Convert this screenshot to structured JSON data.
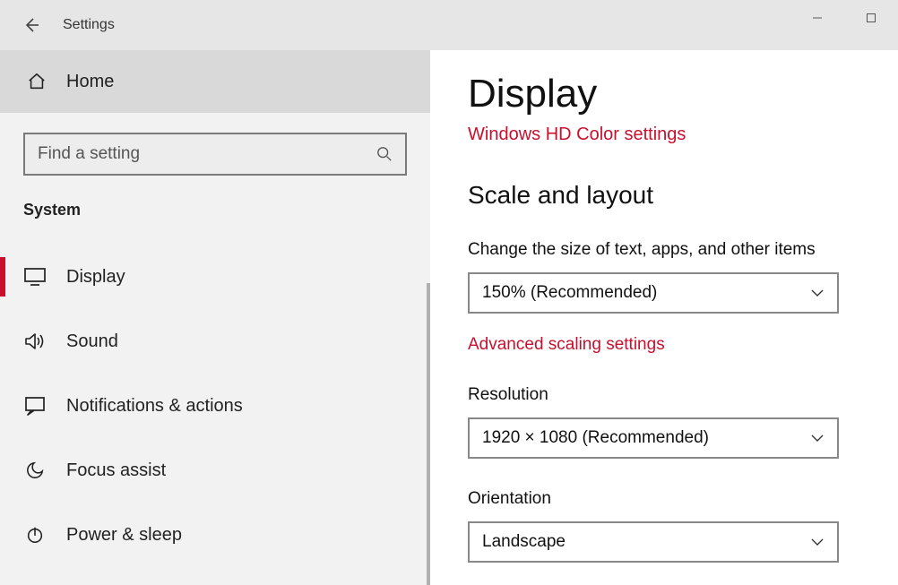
{
  "titlebar": {
    "label": "Settings"
  },
  "sidebar": {
    "home_label": "Home",
    "search_placeholder": "Find a setting",
    "category_label": "System",
    "items": [
      {
        "label": "Display"
      },
      {
        "label": "Sound"
      },
      {
        "label": "Notifications & actions"
      },
      {
        "label": "Focus assist"
      },
      {
        "label": "Power & sleep"
      }
    ]
  },
  "content": {
    "page_title": "Display",
    "hd_color_link": "Windows HD Color settings",
    "scale_section_title": "Scale and layout",
    "scale_label": "Change the size of text, apps, and other items",
    "scale_value": "150% (Recommended)",
    "advanced_scaling_link": "Advanced scaling settings",
    "resolution_label": "Resolution",
    "resolution_value": "1920 × 1080 (Recommended)",
    "orientation_label": "Orientation",
    "orientation_value": "Landscape"
  }
}
